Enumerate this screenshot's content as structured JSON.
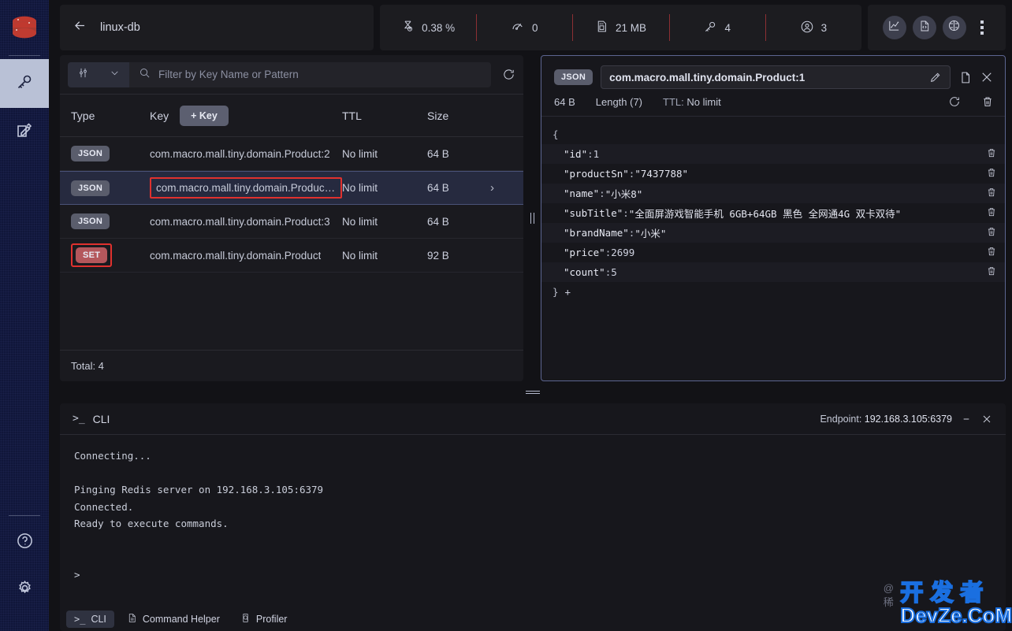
{
  "sidebar": {
    "logo": "redis-logo",
    "items": [
      {
        "name": "browser",
        "icon": "key-icon",
        "active": true
      },
      {
        "name": "workbench",
        "icon": "edit-square-icon",
        "active": false
      }
    ],
    "bottom_items": [
      {
        "name": "help",
        "icon": "question-circle-icon"
      },
      {
        "name": "settings",
        "icon": "gear-icon"
      }
    ]
  },
  "header": {
    "back_label": "back-arrow",
    "db_name": "linux-db",
    "stats": [
      {
        "icon": "hourglass-icon",
        "value": "0.38 %"
      },
      {
        "icon": "gauge-icon",
        "value": "0"
      },
      {
        "icon": "memory-card-icon",
        "value": "21 MB"
      },
      {
        "icon": "key-icon",
        "value": "4"
      },
      {
        "icon": "user-circle-icon",
        "value": "3"
      }
    ],
    "actions": [
      {
        "name": "analysis-tools-button",
        "icon": "chart-icon"
      },
      {
        "name": "slowlog-button",
        "icon": "document-code-icon"
      },
      {
        "name": "ai-assistant-button",
        "icon": "brain-icon"
      },
      {
        "name": "more-options-button",
        "icon": "kebab-icon"
      }
    ]
  },
  "keys_panel": {
    "filter": {
      "type_icon": "filter-sliders-icon",
      "chevron": "chevron-down-icon",
      "search_icon": "search-icon",
      "placeholder": "Filter by Key Name or Pattern",
      "value": "",
      "refresh_icon": "refresh-icon"
    },
    "columns": {
      "type": "Type",
      "key": "Key",
      "ttl": "TTL",
      "size": "Size"
    },
    "add_key_label": "+ Key",
    "rows": [
      {
        "type": "JSON",
        "key": "com.macro.mall.tiny.domain.Product:2",
        "ttl": "No limit",
        "size": "64 B",
        "selected": false,
        "highlight_key": false,
        "highlight_type": false
      },
      {
        "type": "JSON",
        "key": "com.macro.mall.tiny.domain.Product:1",
        "ttl": "No limit",
        "size": "64 B",
        "selected": true,
        "highlight_key": true,
        "highlight_type": false
      },
      {
        "type": "JSON",
        "key": "com.macro.mall.tiny.domain.Product:3",
        "ttl": "No limit",
        "size": "64 B",
        "selected": false,
        "highlight_key": false,
        "highlight_type": false
      },
      {
        "type": "SET",
        "key": "com.macro.mall.tiny.domain.Product",
        "ttl": "No limit",
        "size": "92 B",
        "selected": false,
        "highlight_key": false,
        "highlight_type": true
      }
    ],
    "total_label": "Total: 4"
  },
  "value_panel": {
    "type_badge": "JSON",
    "key_name": "com.macro.mall.tiny.domain.Product:1",
    "edit_icon": "pencil-icon",
    "copy_icon": "copy-icon",
    "close_icon": "close-icon",
    "size": "64 B",
    "length": "Length (7)",
    "ttl_label": "TTL:",
    "ttl_value": "No limit",
    "refresh_icon": "refresh-icon",
    "delete_icon": "trash-icon",
    "json_open": "{",
    "json_close": "}",
    "add_field_icon": "plus-icon",
    "fields": [
      {
        "key": "\"id\"",
        "sep": " : ",
        "value": "1",
        "kind": "num"
      },
      {
        "key": "\"productSn\"",
        "sep": " : ",
        "value": "\"7437788\"",
        "kind": "str"
      },
      {
        "key": "\"name\"",
        "sep": " : ",
        "value": "\"小米8\"",
        "kind": "str"
      },
      {
        "key": "\"subTitle\"",
        "sep": " : ",
        "value": "\"全面屏游戏智能手机 6GB+64GB 黑色 全网通4G 双卡双待\"",
        "kind": "str"
      },
      {
        "key": "\"brandName\"",
        "sep": " : ",
        "value": "\"小米\"",
        "kind": "str"
      },
      {
        "key": "\"price\"",
        "sep": " : ",
        "value": "2699",
        "kind": "num"
      },
      {
        "key": "\"count\"",
        "sep": " : ",
        "value": "5",
        "kind": "num"
      }
    ]
  },
  "cli": {
    "title": "CLI",
    "prompt_glyph": ">_",
    "endpoint_label": "Endpoint:",
    "endpoint_value": "192.168.3.105:6379",
    "minimize_icon": "minimize-icon",
    "close_icon": "close-icon",
    "output": "Connecting...\n\nPinging Redis server on 192.168.3.105:6379\nConnected.\nReady to execute commands.\n\n\n>",
    "tabs": [
      {
        "label": "CLI",
        "icon": "terminal-icon",
        "active": true
      },
      {
        "label": "Command Helper",
        "icon": "document-icon",
        "active": false
      },
      {
        "label": "Profiler",
        "icon": "search-doc-icon",
        "active": false
      }
    ]
  },
  "watermark": {
    "cn": "开发者",
    "en": "DevZe.CoM",
    "at": "@稀"
  },
  "colors": {
    "sidebar_bg": "#10163a",
    "panel_bg": "#1a1a1f",
    "accent_red": "#e0312e",
    "selected_row": "#262a3f",
    "set_badge": "#b4575c",
    "panel_border": "#5c6590"
  }
}
